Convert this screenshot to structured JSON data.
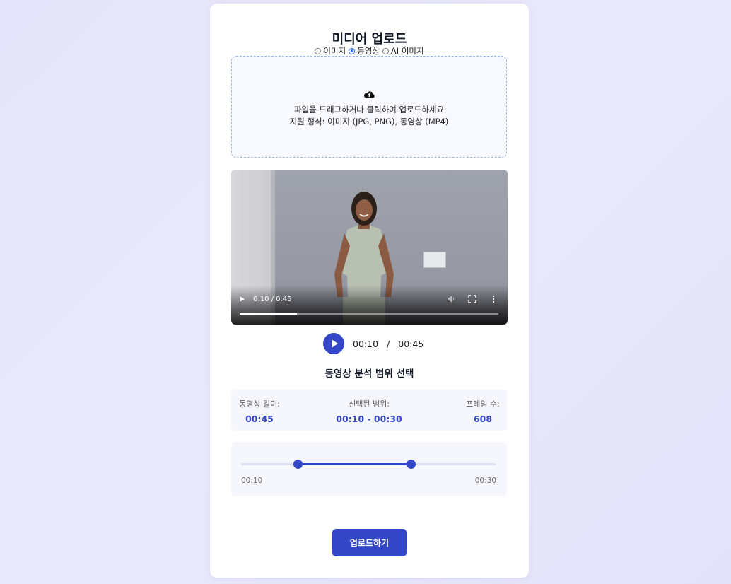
{
  "title": "미디어 업로드",
  "media_type": {
    "options": [
      {
        "label": "이미지",
        "checked": false
      },
      {
        "label": "동영상",
        "checked": true
      },
      {
        "label": "AI 이미지",
        "checked": false
      }
    ]
  },
  "dropzone": {
    "icon": "cloud-upload-icon",
    "main_text": "파일을 드래그하거나 클릭하여 업로드하세요",
    "sub_text": "지원 형식: 이미지 (JPG, PNG), 동영상 (MP4)"
  },
  "video": {
    "time_text": "0:10 / 0:45",
    "progress": 0.222
  },
  "player": {
    "current": "00:10",
    "separator": "/",
    "total": "00:45"
  },
  "range_section": {
    "title": "동영상 분석 범위 선택",
    "stats": [
      {
        "label": "동영상 길이:",
        "value": "00:45"
      },
      {
        "label": "선택된 범위:",
        "value": "00:10 - 00:30"
      },
      {
        "label": "프레임 수:",
        "value": "608"
      }
    ],
    "slider": {
      "start_fraction": 0.222,
      "end_fraction": 0.667,
      "start_label": "00:10",
      "end_label": "00:30"
    }
  },
  "upload_button": "업로드하기",
  "colors": {
    "accent": "#3347c8",
    "background": "#e6e5fb"
  }
}
